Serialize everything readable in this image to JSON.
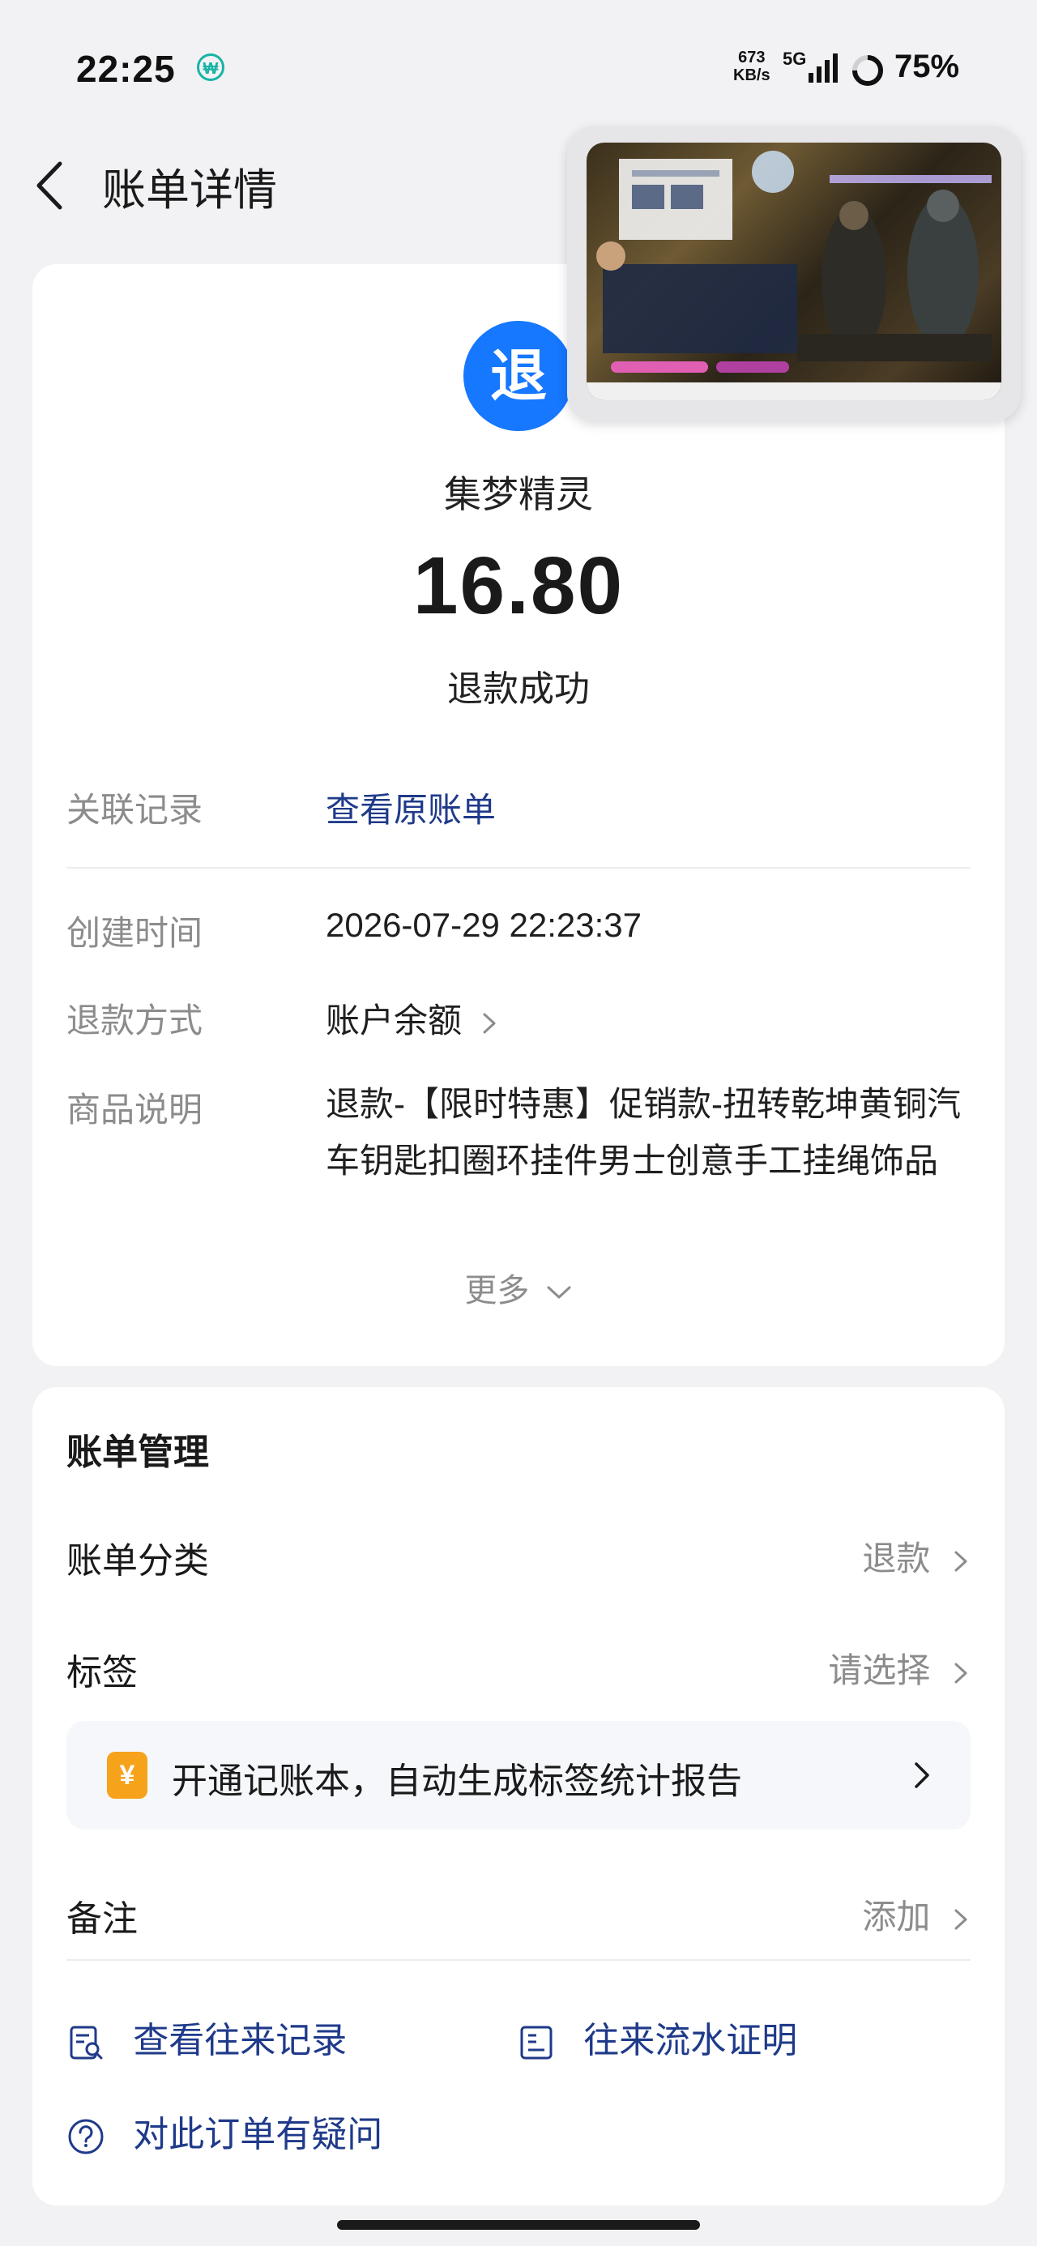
{
  "status_bar": {
    "time": "22:25",
    "network_speed_value": "673",
    "network_speed_unit": "KB/s",
    "network_type": "5G",
    "battery_percent": "75%",
    "icons": [
      "app-notification-icon",
      "signal-icon",
      "battery-ring-icon"
    ]
  },
  "header": {
    "title": "账单详情",
    "back_icon": "chevron-left-icon"
  },
  "floating_window": {
    "content": "floating-video-window"
  },
  "summary": {
    "badge_text": "退",
    "merchant": "集梦精灵",
    "amount": "16.80",
    "status": "退款成功"
  },
  "details": {
    "related_label": "关联记录",
    "related_link": "查看原账单",
    "created_label": "创建时间",
    "created_value": "2026-07-29 22:23:37",
    "refund_method_label": "退款方式",
    "refund_method_value": "账户余额",
    "product_label": "商品说明",
    "product_value": "退款-【限时特惠】促销款-扭转乾坤黄铜汽车钥匙扣圈环挂件男士创意手工挂绳饰品",
    "more_label": "更多"
  },
  "management": {
    "title": "账单管理",
    "category_label": "账单分类",
    "category_value": "退款",
    "tag_label": "标签",
    "tag_value": "请选择",
    "promo_icon_text": "¥",
    "promo_text": "开通记账本，自动生成标签统计报告",
    "note_label": "备注",
    "note_value": "添加",
    "view_records": "查看往来记录",
    "flow_proof": "往来流水证明",
    "question": "对此订单有疑问"
  },
  "colors": {
    "accent_blue": "#1677ff",
    "link_blue": "#1f3a8a",
    "promo_orange": "#f7a21b",
    "background": "#f2f2f4"
  }
}
